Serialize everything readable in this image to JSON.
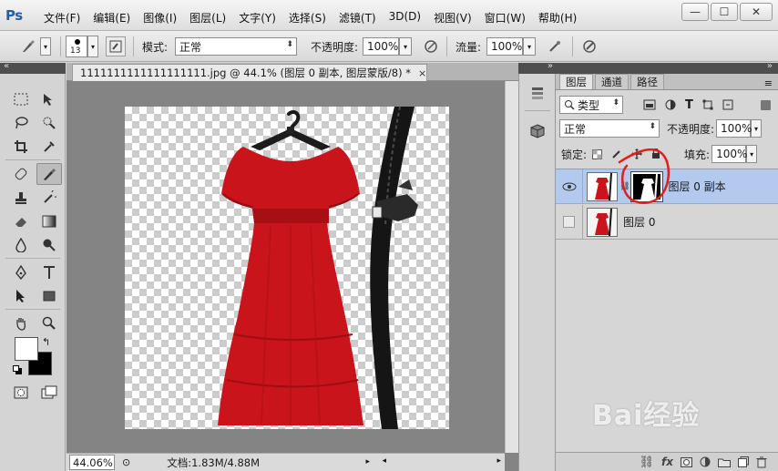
{
  "app": {
    "logo": "Ps",
    "menu": [
      "文件(F)",
      "编辑(E)",
      "图像(I)",
      "图层(L)",
      "文字(Y)",
      "选择(S)",
      "滤镜(T)",
      "3D(D)",
      "视图(V)",
      "窗口(W)",
      "帮助(H)"
    ],
    "window_controls": {
      "minimize": "—",
      "maximize": "☐",
      "close": "✕"
    }
  },
  "options": {
    "brush_size": "13",
    "mode_label": "模式:",
    "mode_value": "正常",
    "opacity_label": "不透明度:",
    "opacity_value": "100%",
    "flow_label": "流量:",
    "flow_value": "100%"
  },
  "document": {
    "tab_title": "1111111111111111111.jpg @ 44.1% (图层 0 副本, 图层蒙版/8) *",
    "tab_close": "×",
    "zoom": "44.06%",
    "doc_info": "文档:1.83M/4.88M"
  },
  "layers_panel": {
    "tabs": [
      "图层",
      "通道",
      "路径"
    ],
    "filter_label": "类型",
    "blend_mode": "正常",
    "opacity_label": "不透明度:",
    "opacity_value": "100%",
    "lock_label": "锁定:",
    "fill_label": "填充:",
    "fill_value": "100%",
    "layers": [
      {
        "name": "图层 0 副本",
        "visible": true,
        "selected": true,
        "has_mask": true
      },
      {
        "name": "图层 0",
        "visible": false,
        "selected": false,
        "has_mask": false
      }
    ],
    "bottom_icons": [
      "link-icon",
      "fx-icon",
      "mask-icon",
      "adjustment-icon",
      "folder-icon",
      "new-layer-icon",
      "trash-icon"
    ]
  },
  "colors": {
    "dress_red": "#c8141a",
    "selection_blue": "#b3c9ee",
    "annotation_red": "#e0201c",
    "ps_blue": "#1f5fae"
  },
  "watermark": "Bai经验"
}
